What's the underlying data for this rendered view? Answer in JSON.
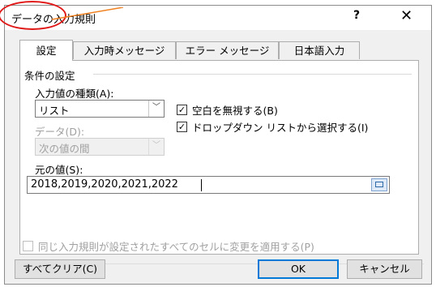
{
  "window": {
    "title": "データの入力規則",
    "help_glyph": "?",
    "close_glyph": "✕"
  },
  "tabs": [
    {
      "label": "設定",
      "active": true
    },
    {
      "label": "入力時メッセージ",
      "active": false
    },
    {
      "label": "エラー メッセージ",
      "active": false
    },
    {
      "label": "日本語入力",
      "active": false
    }
  ],
  "settings": {
    "group_label": "条件の設定",
    "type_label": "入力値の種類(A):",
    "type_value": "リスト",
    "data_label": "データ(D):",
    "data_value": "次の値の間",
    "ignore_blank": {
      "label": "空白を無視する(B)",
      "checked": true
    },
    "dropdown": {
      "label": "ドロップダウン リストから選択する(I)",
      "checked": true
    },
    "source_label": "元の値(S):",
    "source_value": "2018,2019,2020,2021,2022"
  },
  "apply_all": {
    "label": "同じ入力規則が設定されたすべてのセルに変更を適用する(P)",
    "checked": false
  },
  "buttons": {
    "clear_all": "すべてクリア(C)",
    "ok": "OK",
    "cancel": "キャンセル"
  },
  "colors": {
    "annotation": "#e01818",
    "default_button_border": "#0078d7"
  },
  "icons": {
    "check": "check-icon",
    "dropdown": "chevron-down-icon",
    "range_picker": "range-select-icon"
  }
}
